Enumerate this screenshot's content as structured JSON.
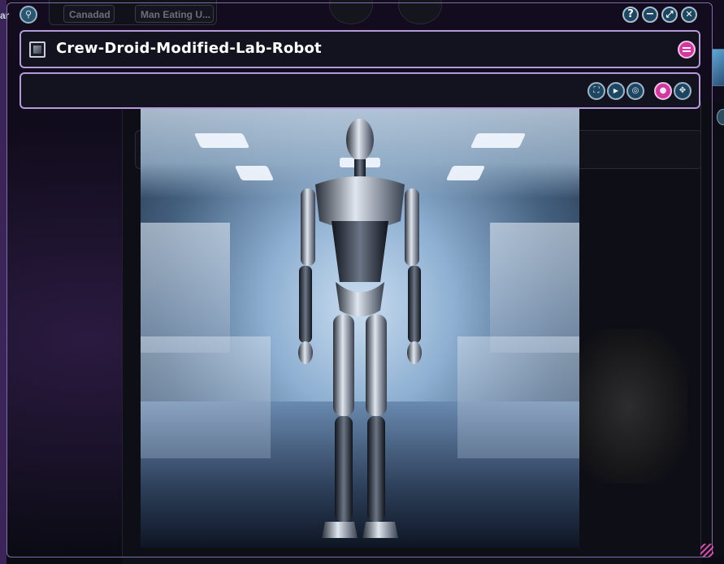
{
  "background": {
    "left_label": "ar",
    "tabs": [
      "Canadad",
      "Man Eating U..."
    ]
  },
  "window": {
    "title": "Crew-Droid-Modified-Lab-Robot",
    "controls": {
      "help": "?",
      "minimize": "−",
      "maximize": "⤢",
      "close": "✕"
    },
    "toolbar": [
      {
        "name": "fullscreen",
        "glyph": "⛶"
      },
      {
        "name": "camera",
        "glyph": "▶"
      },
      {
        "name": "target",
        "glyph": "◎"
      },
      {
        "name": "pin",
        "glyph": "●"
      },
      {
        "name": "move",
        "glyph": "✥"
      }
    ]
  },
  "colors": {
    "accent_pink": "#d2389e",
    "frame_lavender": "#b69ad8",
    "button_blue": "#1f4660"
  }
}
